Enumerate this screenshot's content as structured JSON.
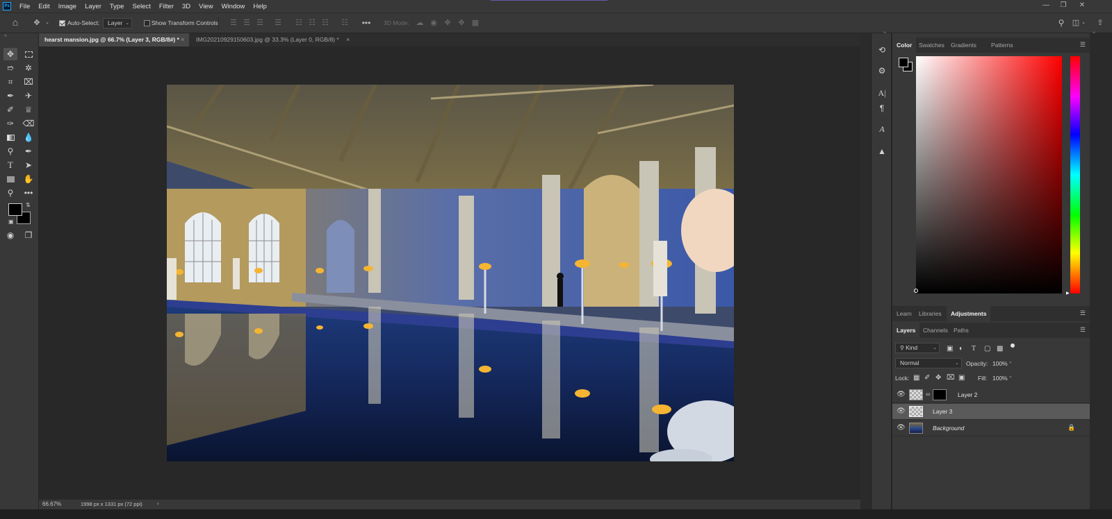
{
  "app": {
    "logo": "Ps",
    "menu": [
      "File",
      "Edit",
      "Image",
      "Layer",
      "Type",
      "Select",
      "Filter",
      "3D",
      "View",
      "Window",
      "Help"
    ]
  },
  "options_bar": {
    "auto_select_label": "Auto-Select:",
    "auto_select_checked": true,
    "auto_select_target": "Layer",
    "show_transform_label": "Show Transform Controls",
    "show_transform_checked": false,
    "mode_3d_label": "3D Mode:"
  },
  "tabs": [
    {
      "label": "hearst mansion.jpg @ 66.7% (Layer 3, RGB/8#) *",
      "active": true
    },
    {
      "label": "IMG20210929150603.jpg @ 33.3% (Layer 0, RGB/8) *",
      "active": false
    }
  ],
  "status": {
    "zoom": "66.67%",
    "doc_info": "1998 px x 1331 px (72 ppi)"
  },
  "color_panel": {
    "tabs": [
      "Color",
      "Swatches",
      "Gradients",
      "Patterns"
    ],
    "active_tab": "Color",
    "hue_color": "#ff0000"
  },
  "learn_panel": {
    "tabs": [
      "Learn",
      "Libraries",
      "Adjustments"
    ],
    "active_tab": "Adjustments"
  },
  "layers_panel": {
    "tabs": [
      "Layers",
      "Channels",
      "Paths"
    ],
    "active_tab": "Layers",
    "filter_kind": "Kind",
    "blend_mode": "Normal",
    "opacity_label": "Opacity:",
    "opacity": "100%",
    "lock_label": "Lock:",
    "fill_label": "Fill:",
    "fill": "100%",
    "layers": [
      {
        "name": "Layer 2",
        "selected": false,
        "has_mask": true,
        "locked": false
      },
      {
        "name": "Layer 3",
        "selected": true,
        "has_mask": false,
        "locked": false
      },
      {
        "name": "Background",
        "selected": false,
        "has_mask": false,
        "locked": true
      }
    ]
  },
  "colors": {
    "foreground": "#000000",
    "background": "#000000"
  }
}
